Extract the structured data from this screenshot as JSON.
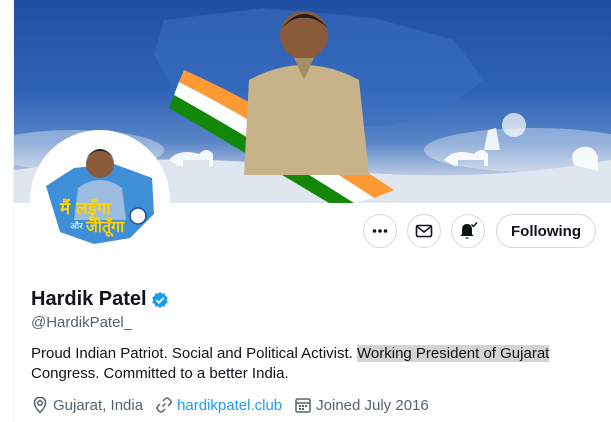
{
  "profile": {
    "name": "Hardik Patel",
    "handle": "@HardikPatel_",
    "bio_part1": "Proud Indian Patriot. Social and Political Activist. ",
    "bio_highlight": "Working President of Gujarat",
    "bio_part2": "Congress. Committed to a better India.",
    "location": "Gujarat, India",
    "website": "hardikpatel.club",
    "joined": "Joined July 2016",
    "avatar_text_line1": "मैं लड़ूँगा",
    "avatar_text_line2": "और",
    "avatar_text_line3": "जीतूँगा"
  },
  "actions": {
    "following_label": "Following"
  },
  "icons": {
    "more": "more-icon",
    "message": "mail-icon",
    "notify": "bell-icon",
    "verified": "verified-badge-icon",
    "location": "location-pin-icon",
    "link": "link-icon",
    "calendar": "calendar-icon"
  },
  "colors": {
    "accent": "#1d9bf0",
    "text": "#0f1419",
    "muted": "#536471",
    "border": "#cfd9de",
    "highlight": "#d3d3d3"
  }
}
